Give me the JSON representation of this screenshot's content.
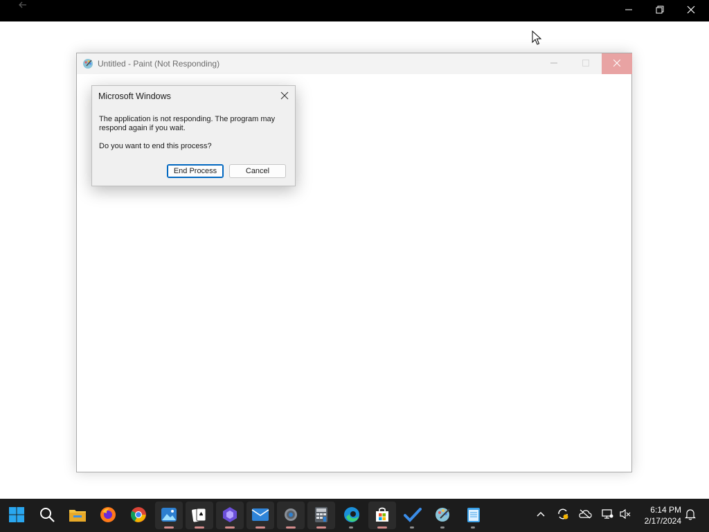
{
  "topbar": {
    "back_icon": "arrow-left-icon",
    "minimize_icon": "minimize-icon",
    "restore_icon": "restore-icon",
    "close_icon": "close-icon"
  },
  "paint_window": {
    "title": "Untitled - Paint (Not Responding)",
    "app_icon": "paint-icon"
  },
  "dialog": {
    "title": "Microsoft Windows",
    "message": "The application is not responding. The program may respond again if you wait.",
    "question": "Do you want to end this process?",
    "end_process_label": "End Process",
    "cancel_label": "Cancel"
  },
  "taskbar": {
    "apps": [
      "start-icon",
      "search-icon",
      "file-explorer-icon",
      "firefox-icon",
      "chrome-icon",
      "photos-icon",
      "solitaire-icon",
      "clipchamp-icon",
      "mail-icon",
      "settings-icon",
      "calculator-icon",
      "edge-icon",
      "store-icon",
      "todo-icon",
      "paint-icon",
      "notepad-icon"
    ],
    "tray": [
      "chevron-up-icon",
      "sync-icon",
      "onedrive-icon",
      "network-icon",
      "volume-muted-icon",
      "notification-icon"
    ],
    "clock": {
      "time": "6:14 PM",
      "date": "2/17/2024"
    }
  },
  "colors": {
    "accent": "#0067c0",
    "taskbar": "#1c1c1c",
    "close_hover": "#e8a3a3"
  }
}
